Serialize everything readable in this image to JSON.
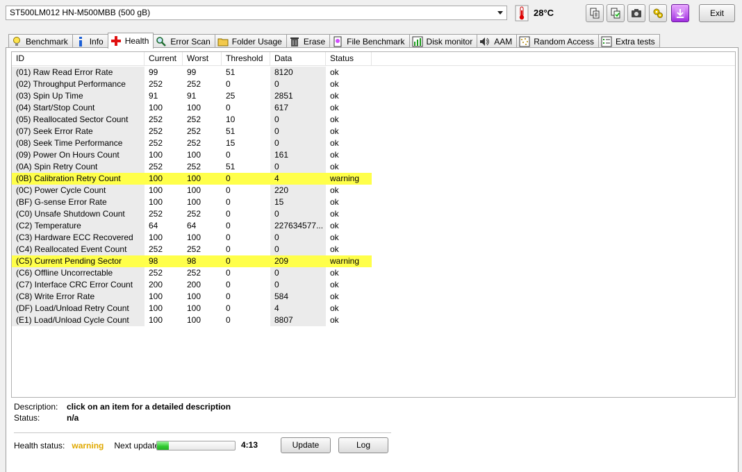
{
  "drive": {
    "selected": "ST500LM012 HN-M500MBB (500 gB)"
  },
  "temperature": "28°C",
  "toolbar": {
    "exit_label": "Exit"
  },
  "tabs": [
    {
      "label": "Benchmark",
      "icon": "lightbulb-icon"
    },
    {
      "label": "Info",
      "icon": "info-icon"
    },
    {
      "label": "Health",
      "icon": "red-cross-icon",
      "active": true
    },
    {
      "label": "Error Scan",
      "icon": "magnifier-icon"
    },
    {
      "label": "Folder Usage",
      "icon": "folder-icon"
    },
    {
      "label": "Erase",
      "icon": "trash-icon"
    },
    {
      "label": "File Benchmark",
      "icon": "file-icon"
    },
    {
      "label": "Disk monitor",
      "icon": "chart-icon"
    },
    {
      "label": "AAM",
      "icon": "speaker-icon"
    },
    {
      "label": "Random Access",
      "icon": "dots-icon"
    },
    {
      "label": "Extra tests",
      "icon": "list-icon"
    }
  ],
  "columns": [
    "ID",
    "Current",
    "Worst",
    "Threshold",
    "Data",
    "Status"
  ],
  "rows": [
    {
      "id": "(01) Raw Read Error Rate",
      "current": "99",
      "worst": "99",
      "threshold": "51",
      "data": "8120",
      "status": "ok"
    },
    {
      "id": "(02) Throughput Performance",
      "current": "252",
      "worst": "252",
      "threshold": "0",
      "data": "0",
      "status": "ok"
    },
    {
      "id": "(03) Spin Up Time",
      "current": "91",
      "worst": "91",
      "threshold": "25",
      "data": "2851",
      "status": "ok"
    },
    {
      "id": "(04) Start/Stop Count",
      "current": "100",
      "worst": "100",
      "threshold": "0",
      "data": "617",
      "status": "ok"
    },
    {
      "id": "(05) Reallocated Sector Count",
      "current": "252",
      "worst": "252",
      "threshold": "10",
      "data": "0",
      "status": "ok"
    },
    {
      "id": "(07) Seek Error Rate",
      "current": "252",
      "worst": "252",
      "threshold": "51",
      "data": "0",
      "status": "ok"
    },
    {
      "id": "(08) Seek Time Performance",
      "current": "252",
      "worst": "252",
      "threshold": "15",
      "data": "0",
      "status": "ok"
    },
    {
      "id": "(09) Power On Hours Count",
      "current": "100",
      "worst": "100",
      "threshold": "0",
      "data": "161",
      "status": "ok"
    },
    {
      "id": "(0A) Spin Retry Count",
      "current": "252",
      "worst": "252",
      "threshold": "51",
      "data": "0",
      "status": "ok"
    },
    {
      "id": "(0B) Calibration Retry Count",
      "current": "100",
      "worst": "100",
      "threshold": "0",
      "data": "4",
      "status": "warning",
      "warn": true
    },
    {
      "id": "(0C) Power Cycle Count",
      "current": "100",
      "worst": "100",
      "threshold": "0",
      "data": "220",
      "status": "ok"
    },
    {
      "id": "(BF) G-sense Error Rate",
      "current": "100",
      "worst": "100",
      "threshold": "0",
      "data": "15",
      "status": "ok"
    },
    {
      "id": "(C0) Unsafe Shutdown Count",
      "current": "252",
      "worst": "252",
      "threshold": "0",
      "data": "0",
      "status": "ok"
    },
    {
      "id": "(C2) Temperature",
      "current": "64",
      "worst": "64",
      "threshold": "0",
      "data": "227634577...",
      "status": "ok"
    },
    {
      "id": "(C3) Hardware ECC Recovered",
      "current": "100",
      "worst": "100",
      "threshold": "0",
      "data": "0",
      "status": "ok"
    },
    {
      "id": "(C4) Reallocated Event Count",
      "current": "252",
      "worst": "252",
      "threshold": "0",
      "data": "0",
      "status": "ok"
    },
    {
      "id": "(C5) Current Pending Sector",
      "current": "98",
      "worst": "98",
      "threshold": "0",
      "data": "209",
      "status": "warning",
      "warn": true
    },
    {
      "id": "(C6) Offline Uncorrectable",
      "current": "252",
      "worst": "252",
      "threshold": "0",
      "data": "0",
      "status": "ok"
    },
    {
      "id": "(C7) Interface CRC Error Count",
      "current": "200",
      "worst": "200",
      "threshold": "0",
      "data": "0",
      "status": "ok"
    },
    {
      "id": "(C8) Write Error Rate",
      "current": "100",
      "worst": "100",
      "threshold": "0",
      "data": "584",
      "status": "ok"
    },
    {
      "id": "(DF) Load/Unload Retry Count",
      "current": "100",
      "worst": "100",
      "threshold": "0",
      "data": "4",
      "status": "ok"
    },
    {
      "id": "(E1) Load/Unload Cycle Count",
      "current": "100",
      "worst": "100",
      "threshold": "0",
      "data": "8807",
      "status": "ok"
    }
  ],
  "description": {
    "label": "Description:",
    "value": "click on an item for a detailed description"
  },
  "status": {
    "label": "Status:",
    "value": "n/a"
  },
  "health": {
    "label": "Health status:",
    "value": "warning",
    "color": "#e0a800"
  },
  "next_update": {
    "label": "Next update:",
    "progress": 0.15,
    "countdown": "4:13"
  },
  "buttons": {
    "update": "Update",
    "log": "Log"
  }
}
